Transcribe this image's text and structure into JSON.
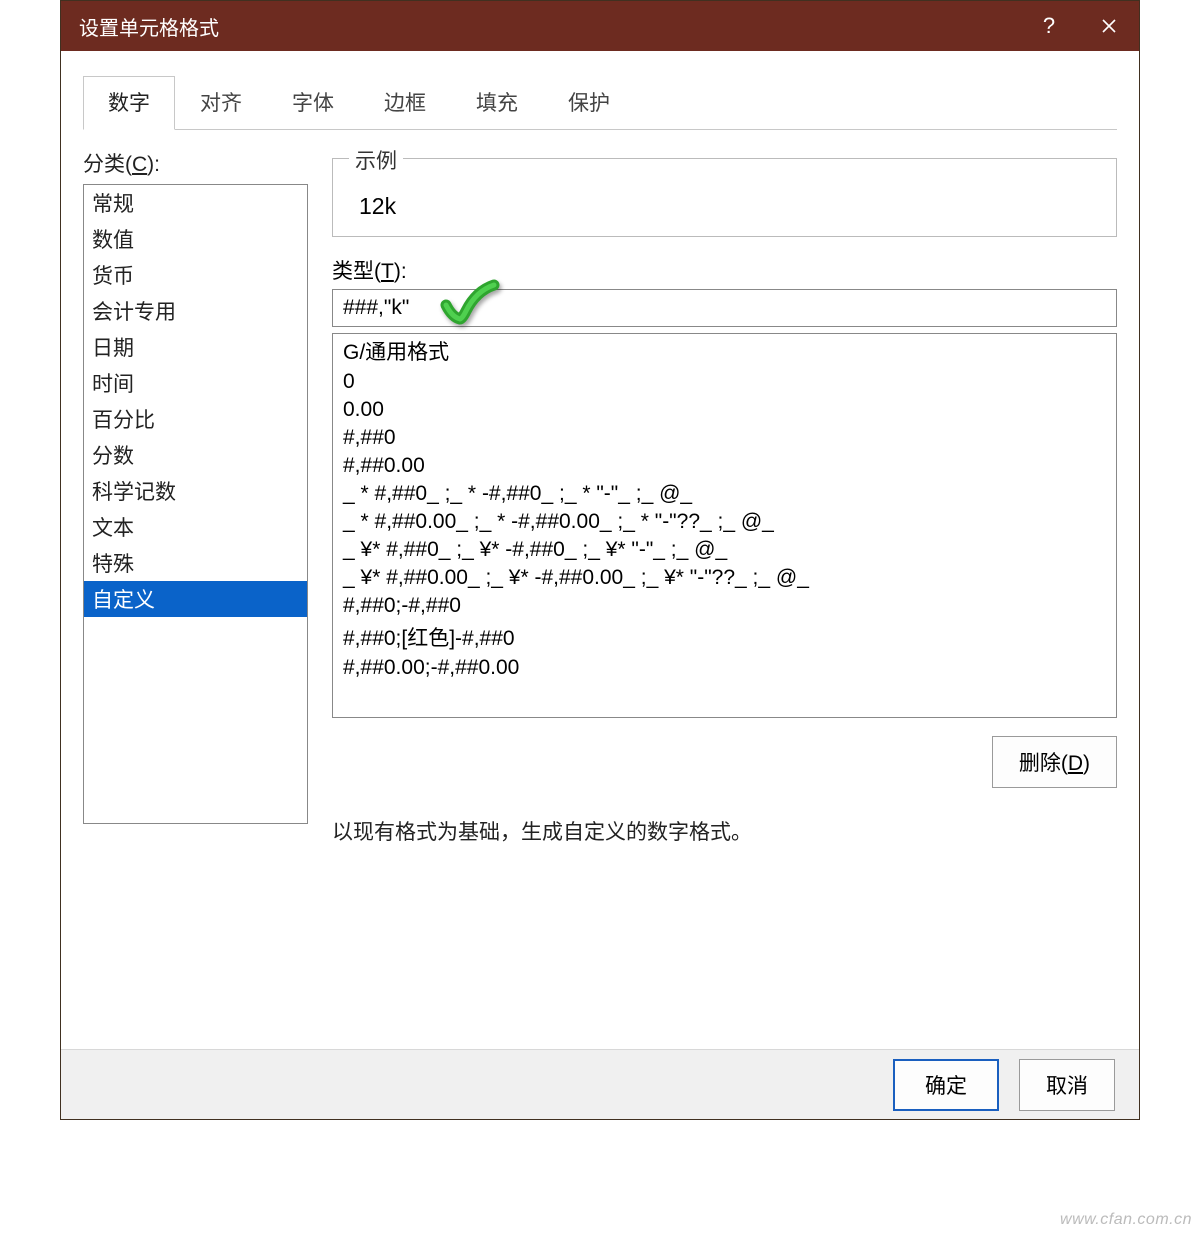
{
  "window": {
    "title": "设置单元格格式"
  },
  "tabs": [
    "数字",
    "对齐",
    "字体",
    "边框",
    "填充",
    "保护"
  ],
  "active_tab_index": 0,
  "category": {
    "label_pre": "分类(",
    "label_u": "C",
    "label_post": "):",
    "items": [
      "常规",
      "数值",
      "货币",
      "会计专用",
      "日期",
      "时间",
      "百分比",
      "分数",
      "科学记数",
      "文本",
      "特殊",
      "自定义"
    ],
    "selected_index": 11
  },
  "sample": {
    "legend": "示例",
    "value": "12k"
  },
  "type": {
    "label_pre": "类型(",
    "label_u": "T",
    "label_post": "):",
    "value": "###,\"k\"",
    "options": [
      "G/通用格式",
      "0",
      "0.00",
      "#,##0",
      "#,##0.00",
      "_ * #,##0_ ;_ * -#,##0_ ;_ * \"-\"_ ;_ @_ ",
      "_ * #,##0.00_ ;_ * -#,##0.00_ ;_ * \"-\"??_ ;_ @_ ",
      "_ ¥* #,##0_ ;_ ¥* -#,##0_ ;_ ¥* \"-\"_ ;_ @_ ",
      "_ ¥* #,##0.00_ ;_ ¥* -#,##0.00_ ;_ ¥* \"-\"??_ ;_ @_ ",
      "#,##0;-#,##0",
      "#,##0;[红色]-#,##0",
      "#,##0.00;-#,##0.00"
    ]
  },
  "buttons": {
    "delete_pre": "删除(",
    "delete_u": "D",
    "delete_post": ")",
    "ok": "确定",
    "cancel": "取消"
  },
  "hint": "以现有格式为基础，生成自定义的数字格式。",
  "watermark": "www.cfan.com.cn"
}
